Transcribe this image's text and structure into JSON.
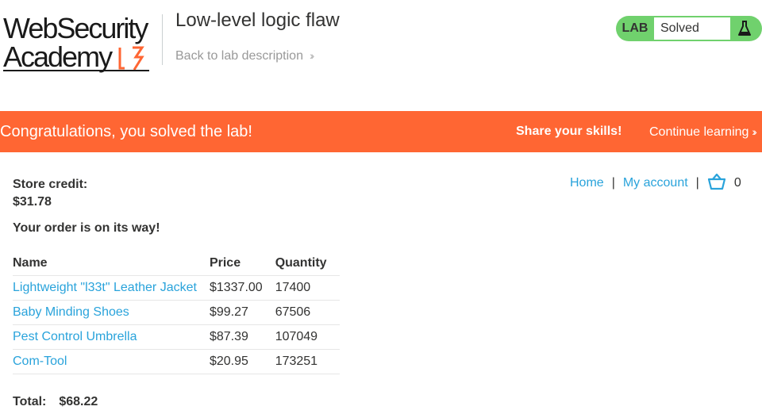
{
  "header": {
    "logo_line1": "WebSecurity",
    "logo_line2": "Academy",
    "lab_title": "Low-level logic flaw",
    "back_link": "Back to lab description",
    "lab_badge": "LAB",
    "lab_status": "Solved",
    "lab_icon": "flask-icon"
  },
  "banner": {
    "message": "Congratulations, you solved the lab!",
    "share": "Share your skills!",
    "continue": "Continue learning",
    "color": "#ff6633"
  },
  "nav": {
    "home": "Home",
    "separator": "|",
    "my_account": "My account",
    "cart_icon": "cart-icon",
    "cart_count": "0"
  },
  "account": {
    "credit_label": "Store credit:",
    "credit_value": "$31.78",
    "order_message": "Your order is on its way!"
  },
  "orders": {
    "headers": [
      "Name",
      "Price",
      "Quantity"
    ],
    "rows": [
      {
        "name": "Lightweight \"l33t\" Leather Jacket",
        "price": "$1337.00",
        "quantity": "17400"
      },
      {
        "name": "Baby Minding Shoes",
        "price": "$99.27",
        "quantity": "67506"
      },
      {
        "name": "Pest Control Umbrella",
        "price": "$87.39",
        "quantity": "107049"
      },
      {
        "name": "Com-Tool",
        "price": "$20.95",
        "quantity": "173251"
      }
    ],
    "total_label": "Total:",
    "total_value": "$68.22"
  },
  "colors": {
    "accent": "#ff6633",
    "link": "#29a3db",
    "solved": "#70d16d"
  }
}
